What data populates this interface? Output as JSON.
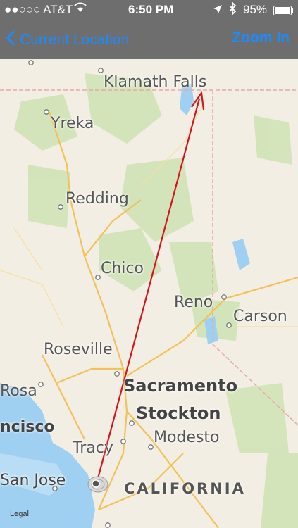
{
  "status": {
    "carrier": "●●○○○ AT&T",
    "time": "6:50 PM",
    "battery": "95%",
    "icons": [
      "wifi-icon",
      "location-arrow-icon",
      "bluetooth-icon",
      "battery-icon"
    ]
  },
  "nav": {
    "back_label": "Current Location",
    "right_label": "Zoom In"
  },
  "map": {
    "cities": [
      {
        "name": "Klamath Falls"
      },
      {
        "name": "Yreka"
      },
      {
        "name": "Redding"
      },
      {
        "name": "Chico"
      },
      {
        "name": "Reno"
      },
      {
        "name": "Carson"
      },
      {
        "name": "Roseville"
      },
      {
        "name": "Sacramento"
      },
      {
        "name": "Stockton"
      },
      {
        "name": "Modesto"
      },
      {
        "name": "Tracy"
      },
      {
        "name": "Rosa"
      },
      {
        "name": "ncisco"
      },
      {
        "name": "San Jose"
      }
    ],
    "state_label": "CALIFORNIA",
    "legal": "Legal"
  },
  "colors": {
    "accent": "#1a8cff",
    "route": "#d4141c",
    "water": "#9fd0f2",
    "land": "#f3eee3",
    "park": "#cfe3b4"
  }
}
